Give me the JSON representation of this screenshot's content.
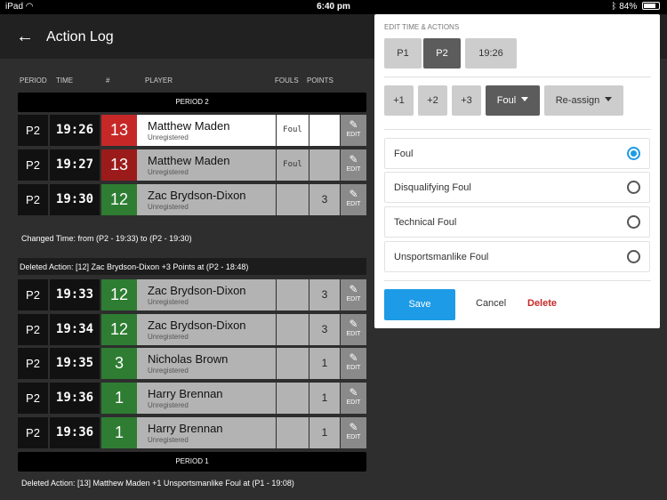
{
  "status_bar": {
    "device": "iPad",
    "time": "6:40 pm",
    "battery": "84%",
    "battery_level": 0.84
  },
  "app_bar": {
    "title": "Action Log"
  },
  "columns": {
    "period": "PERIOD",
    "time": "TIME",
    "number": "#",
    "player": "PLAYER",
    "fouls": "FOULS",
    "points": "POINTS"
  },
  "log": {
    "period2_header": "PERIOD 2",
    "period1_header": "PERIOD 1",
    "edit_label": "EDIT",
    "rows": [
      {
        "period": "P2",
        "time": "19:26",
        "number": "13",
        "color": "#c62828",
        "name": "Matthew Maden",
        "status": "Unregistered",
        "fouls": "Foul",
        "points": ""
      },
      {
        "period": "P2",
        "time": "19:27",
        "number": "13",
        "color": "#9b1b1b",
        "name": "Matthew Maden",
        "status": "Unregistered",
        "fouls": "Foul",
        "points": ""
      },
      {
        "period": "P2",
        "time": "19:30",
        "number": "12",
        "color": "#2e7d32",
        "name": "Zac Brydson-Dixon",
        "status": "Unregistered",
        "fouls": "",
        "points": "3"
      },
      {
        "period": "P2",
        "time": "19:33",
        "number": "12",
        "color": "#2e7d32",
        "name": "Zac Brydson-Dixon",
        "status": "Unregistered",
        "fouls": "",
        "points": "3"
      },
      {
        "period": "P2",
        "time": "19:34",
        "number": "12",
        "color": "#2e7d32",
        "name": "Zac Brydson-Dixon",
        "status": "Unregistered",
        "fouls": "",
        "points": "3"
      },
      {
        "period": "P2",
        "time": "19:35",
        "number": "3",
        "color": "#2e7d32",
        "name": "Nicholas Brown",
        "status": "Unregistered",
        "fouls": "",
        "points": "1"
      },
      {
        "period": "P2",
        "time": "19:36",
        "number": "1",
        "color": "#2e7d32",
        "name": "Harry Brennan",
        "status": "Unregistered",
        "fouls": "",
        "points": "1"
      },
      {
        "period": "P2",
        "time": "19:36",
        "number": "1",
        "color": "#2e7d32",
        "name": "Harry Brennan",
        "status": "Unregistered",
        "fouls": "",
        "points": "1"
      }
    ],
    "changed_time_note": "Changed Time: from (P2 - 19:33) to (P2 - 19:30)",
    "deleted_note_1": "Deleted Action: [12] Zac Brydson-Dixon +3 Points at (P2 - 18:48)",
    "deleted_note_2": "Deleted Action: [13] Matthew Maden +1 Unsportsmanlike Foul at (P1 - 19:08)"
  },
  "edit_panel": {
    "header": "EDIT TIME & ACTIONS",
    "period_buttons": [
      "P1",
      "P2"
    ],
    "selected_period": "P2",
    "time_value": "19:26",
    "action_buttons": [
      "+1",
      "+2",
      "+3"
    ],
    "foul_label": "Foul",
    "reassign_label": "Re-assign",
    "options": [
      {
        "label": "Foul",
        "selected": true
      },
      {
        "label": "Disqualifying Foul",
        "selected": false
      },
      {
        "label": "Technical Foul",
        "selected": false
      },
      {
        "label": "Unsportsmanlike Foul",
        "selected": false
      }
    ],
    "save_label": "Save",
    "cancel_label": "Cancel",
    "delete_label": "Delete"
  }
}
